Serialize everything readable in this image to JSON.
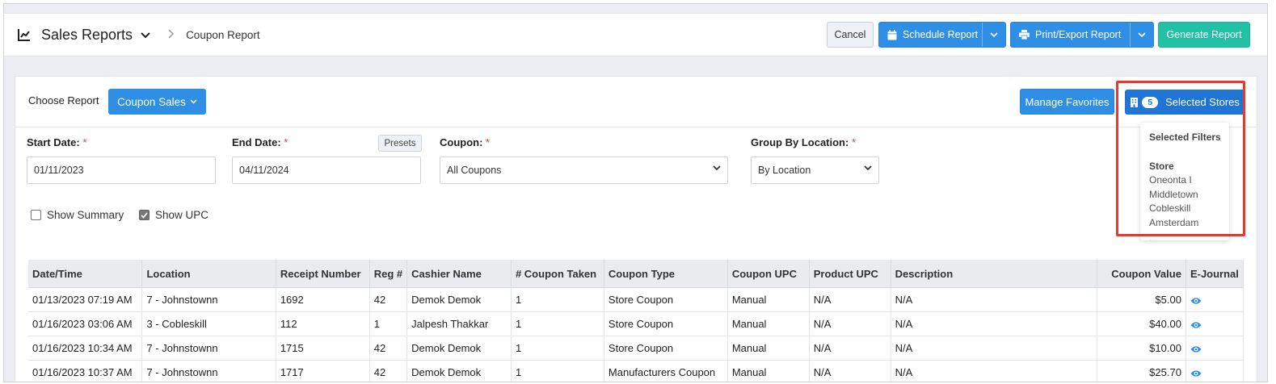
{
  "header": {
    "title": "Sales Reports",
    "breadcrumb": "Coupon Report",
    "buttons": {
      "cancel": "Cancel",
      "schedule": "Schedule Report",
      "print_export": "Print/Export Report",
      "generate": "Generate Report"
    }
  },
  "controls": {
    "choose_report_label": "Choose Report",
    "report_selected": "Coupon Sales",
    "manage_favorites": "Manage Favorites",
    "selected_stores_count": "5",
    "selected_stores_label": "Selected Stores"
  },
  "filters": {
    "start_date_label": "Start Date:",
    "start_date_value": "01/11/2023",
    "end_date_label": "End Date:",
    "end_date_value": "04/11/2024",
    "presets_label": "Presets",
    "coupon_label": "Coupon:",
    "coupon_value": "All Coupons",
    "group_label": "Group By Location:",
    "group_value": "By Location",
    "required_mark": "*"
  },
  "options": {
    "show_summary_label": "Show Summary",
    "show_summary_checked": false,
    "show_upc_label": "Show UPC",
    "show_upc_checked": true
  },
  "popover": {
    "title": "Selected Filters",
    "store_heading": "Store",
    "stores": [
      "Oneonta I",
      "Middletown",
      "Cobleskill",
      "Amsterdam"
    ],
    "more": "..."
  },
  "table": {
    "columns": [
      "Date/Time",
      "Location",
      "Receipt Number",
      "Reg #",
      "Cashier Name",
      "# Coupon Taken",
      "Coupon Type",
      "Coupon UPC",
      "Product UPC",
      "Description",
      "Coupon Value",
      "E-Journal"
    ],
    "rows": [
      [
        "01/13/2023 07:19 AM",
        "7 - Johnstownn",
        "1692",
        "42",
        "Demok Demok",
        "1",
        "Store Coupon",
        "Manual",
        "N/A",
        "N/A",
        "$5.00"
      ],
      [
        "01/16/2023 03:06 AM",
        "3 - Cobleskill",
        "112",
        "1",
        "Jalpesh Thakkar",
        "1",
        "Store Coupon",
        "Manual",
        "N/A",
        "N/A",
        "$40.00"
      ],
      [
        "01/16/2023 10:34 AM",
        "7 - Johnstownn",
        "1715",
        "42",
        "Demok Demok",
        "1",
        "Store Coupon",
        "Manual",
        "N/A",
        "N/A",
        "$10.00"
      ],
      [
        "01/16/2023 10:37 AM",
        "7 - Johnstownn",
        "1717",
        "42",
        "Demok Demok",
        "1",
        "Manufacturers Coupon",
        "Manual",
        "N/A",
        "N/A",
        "$25.70"
      ]
    ]
  },
  "colors": {
    "primary": "#2f8ee5",
    "teal": "#21c1a6",
    "highlight": "#e53935",
    "required": "#e53935"
  }
}
